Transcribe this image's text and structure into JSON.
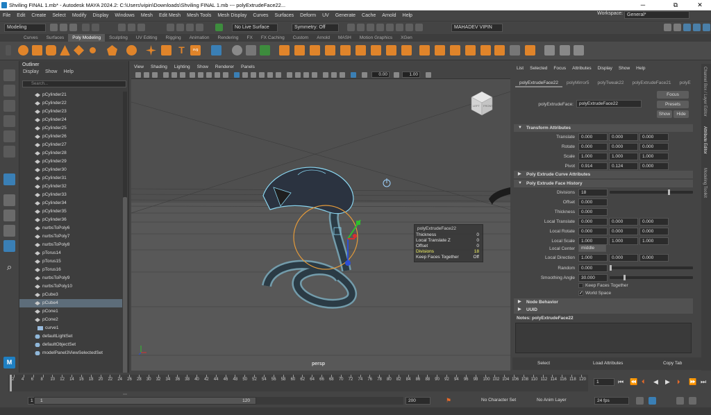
{
  "titlebar": {
    "text": "Shviling FINAL 1.mb* - Autodesk MAYA 2024.2: C:\\Users\\vipin\\Downloads\\Shviling FINAL 1.mb  ---  polyExtrudeFace22...",
    "minimize": "─",
    "maximize": "⧉",
    "close": "✕"
  },
  "menubar": {
    "items": [
      "File",
      "Edit",
      "Create",
      "Select",
      "Modify",
      "Display",
      "Windows",
      "Mesh",
      "Edit Mesh",
      "Mesh Tools",
      "Mesh Display",
      "Curves",
      "Surfaces",
      "Deform",
      "UV",
      "Generate",
      "Cache",
      "Arnold",
      "Help"
    ],
    "workspace_label": "Workspace:",
    "workspace_value": "General*"
  },
  "status_line": {
    "mode": "Modeling",
    "live_surface": "No Live Surface",
    "symmetry": "Symmetry: Off",
    "user": "MAHADEV VIPIN"
  },
  "shelf_tabs": [
    "Curves",
    "Surfaces",
    "Poly Modeling",
    "Sculpting",
    "UV Editing",
    "Rigging",
    "Animation",
    "Rendering",
    "FX",
    "FX Caching",
    "Custom",
    "Arnold",
    "MASH",
    "Motion Graphics",
    "XGen"
  ],
  "shelf_active": "Poly Modeling",
  "outliner": {
    "title": "Outliner",
    "menu": [
      "Display",
      "Show",
      "Help"
    ],
    "search_placeholder": "Search...",
    "items": [
      "pCylinder21",
      "pCylinder22",
      "pCylinder23",
      "pCylinder24",
      "pCylinder25",
      "pCylinder26",
      "pCylinder27",
      "pCylinder28",
      "pCylinder29",
      "pCylinder30",
      "pCylinder31",
      "pCylinder32",
      "pCylinder33",
      "pCylinder34",
      "pCylinder35",
      "pCylinder36",
      "nurbsToPoly6",
      "nurbsToPoly7",
      "nurbsToPoly8",
      "pTorus14",
      "pTorus15",
      "pTorus16",
      "nurbsToPoly9",
      "nurbsToPoly10",
      "pCube3",
      "pCube4",
      "pCone1",
      "pCone2",
      "curve1",
      "defaultLightSet",
      "defaultObjectSet",
      "modelPanel3ViewSelectedSet"
    ],
    "selected": "pCube4"
  },
  "viewport": {
    "menu": [
      "View",
      "Shading",
      "Lighting",
      "Show",
      "Renderer",
      "Panels"
    ],
    "near_value": "0.00",
    "far_value": "1.00",
    "camera_label": "persp",
    "viewcube_left": "LEFT",
    "viewcube_front": "FRONT"
  },
  "hud": {
    "title": "polyExtrudeFace22",
    "rows": [
      {
        "label": "Thickness",
        "value": "0"
      },
      {
        "label": "Local Translate Z",
        "value": "0"
      },
      {
        "label": "Offset",
        "value": "0"
      },
      {
        "label": "Divisions",
        "value": "18"
      },
      {
        "label": "Keep Faces Together",
        "value": "Off"
      }
    ],
    "highlighted": "Divisions"
  },
  "attribute_editor": {
    "menu": [
      "List",
      "Selected",
      "Focus",
      "Attributes",
      "Display",
      "Show",
      "Help"
    ],
    "tabs": [
      "polyExtrudeFace22",
      "polyMirror5",
      "polyTweak22",
      "polyExtrudeFace21",
      "polyE"
    ],
    "node_label": "polyExtrudeFace:",
    "node_name": "polyExtrudeFace22",
    "focus": "Focus",
    "presets": "Presets",
    "show": "Show",
    "hide": "Hide",
    "sections": {
      "transform": "Transform Attributes",
      "curve": "Poly Extrude Curve Attributes",
      "history": "Poly Extrude Face History",
      "node_behavior": "Node Behavior",
      "uuid": "UUID"
    },
    "translate": {
      "label": "Translate",
      "values": [
        "0.000",
        "0.000",
        "0.000"
      ]
    },
    "rotate": {
      "label": "Rotate",
      "values": [
        "0.000",
        "0.000",
        "0.000"
      ]
    },
    "scale": {
      "label": "Scale",
      "values": [
        "1.000",
        "1.000",
        "1.000"
      ]
    },
    "pivot": {
      "label": "Pivot",
      "values": [
        "0.914",
        "0.124",
        "0.000"
      ]
    },
    "divisions": {
      "label": "Divisions",
      "value": "18",
      "slider_fraction": 0.72
    },
    "offset": {
      "label": "Offset",
      "value": "0.000"
    },
    "thickness": {
      "label": "Thickness",
      "value": "0.000"
    },
    "local_translate": {
      "label": "Local Translate",
      "values": [
        "0.000",
        "0.000",
        "0.000"
      ]
    },
    "local_rotate": {
      "label": "Local Rotate",
      "values": [
        "0.000",
        "0.000",
        "0.000"
      ]
    },
    "local_scale": {
      "label": "Local Scale",
      "values": [
        "1.000",
        "1.000",
        "1.000"
      ]
    },
    "local_center": {
      "label": "Local Center",
      "value": "middle"
    },
    "local_direction": {
      "label": "Local Direction",
      "values": [
        "1.000",
        "0.000",
        "0.000"
      ]
    },
    "random": {
      "label": "Random",
      "value": "0.000",
      "slider_fraction": 0.0
    },
    "smoothing_angle": {
      "label": "Smoothing Angle",
      "value": "30.000",
      "slider_fraction": 0.17
    },
    "keep_faces_together": {
      "label": "Keep Faces Together",
      "checked": false
    },
    "world_space": {
      "label": "World Space",
      "checked": true
    },
    "notes_label": "Notes:  polyExtrudeFace22",
    "footer": {
      "select": "Select",
      "load_attributes": "Load Attributes",
      "copy_tab": "Copy Tab"
    }
  },
  "side_tabs": [
    "Channel Box / Layer Editor",
    "Attribute Editor",
    "Modeling Toolkit"
  ],
  "timeline": {
    "ticks": [
      "2",
      "4",
      "6",
      "8",
      "10",
      "12",
      "14",
      "16",
      "18",
      "20",
      "22",
      "24",
      "26",
      "28",
      "30",
      "32",
      "34",
      "36",
      "38",
      "40",
      "42",
      "44",
      "46",
      "48",
      "50",
      "52",
      "54",
      "56",
      "58",
      "60",
      "62",
      "64",
      "66",
      "68",
      "70",
      "72",
      "74",
      "76",
      "78",
      "80",
      "82",
      "84",
      "86",
      "88",
      "90",
      "92",
      "94",
      "96",
      "98",
      "100",
      "102",
      "104",
      "106",
      "108",
      "110",
      "112",
      "114",
      "116",
      "118",
      "120"
    ],
    "current_frame": "1"
  },
  "range": {
    "start": "1",
    "inner_start": "1",
    "inner_end": "120",
    "end": "200",
    "character_set": "No Character Set",
    "anim_layer": "No Anim Layer",
    "fps": "24 fps"
  }
}
